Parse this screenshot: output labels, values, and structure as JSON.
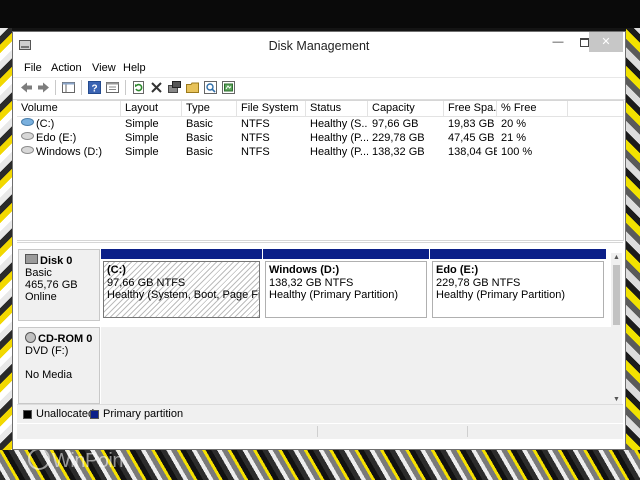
{
  "window": {
    "title": "Disk Management"
  },
  "menu": [
    "File",
    "Action",
    "View",
    "Help"
  ],
  "toolbar": [
    "back-icon",
    "forward-icon",
    "console-tree-icon",
    "help-icon",
    "properties-icon",
    "refresh-icon",
    "delete-icon",
    "connect-icon",
    "open-icon",
    "search-icon",
    "export-icon"
  ],
  "columns": [
    "Volume",
    "Layout",
    "Type",
    "File System",
    "Status",
    "Capacity",
    "Free Spa...",
    "% Free"
  ],
  "volumes": [
    {
      "name": "(C:)",
      "layout": "Simple",
      "type": "Basic",
      "fs": "NTFS",
      "status": "Healthy (S...",
      "capacity": "97,66 GB",
      "free": "19,83 GB",
      "pct": "20 %"
    },
    {
      "name": "Edo (E:)",
      "layout": "Simple",
      "type": "Basic",
      "fs": "NTFS",
      "status": "Healthy (P...",
      "capacity": "229,78 GB",
      "free": "47,45 GB",
      "pct": "21 %"
    },
    {
      "name": "Windows (D:)",
      "layout": "Simple",
      "type": "Basic",
      "fs": "NTFS",
      "status": "Healthy (P...",
      "capacity": "138,32 GB",
      "free": "138,04 GB",
      "pct": "100 %"
    }
  ],
  "disk0": {
    "name": "Disk 0",
    "type": "Basic",
    "size": "465,76 GB",
    "state": "Online",
    "partitions": [
      {
        "name": "(C:)",
        "size": "97,66 GB NTFS",
        "status": "Healthy (System, Boot, Page File, Ac"
      },
      {
        "name": "Windows  (D:)",
        "size": "138,32 GB NTFS",
        "status": "Healthy (Primary Partition)"
      },
      {
        "name": "Edo  (E:)",
        "size": "229,78 GB NTFS",
        "status": "Healthy (Primary Partition)"
      }
    ]
  },
  "cdrom0": {
    "name": "CD-ROM 0",
    "type": "DVD (F:)",
    "state": "No Media"
  },
  "legend": [
    {
      "label": "Unallocated",
      "color": "#000000"
    },
    {
      "label": "Primary partition",
      "color": "#0b1f88"
    }
  ],
  "watermark": "WinPoin"
}
